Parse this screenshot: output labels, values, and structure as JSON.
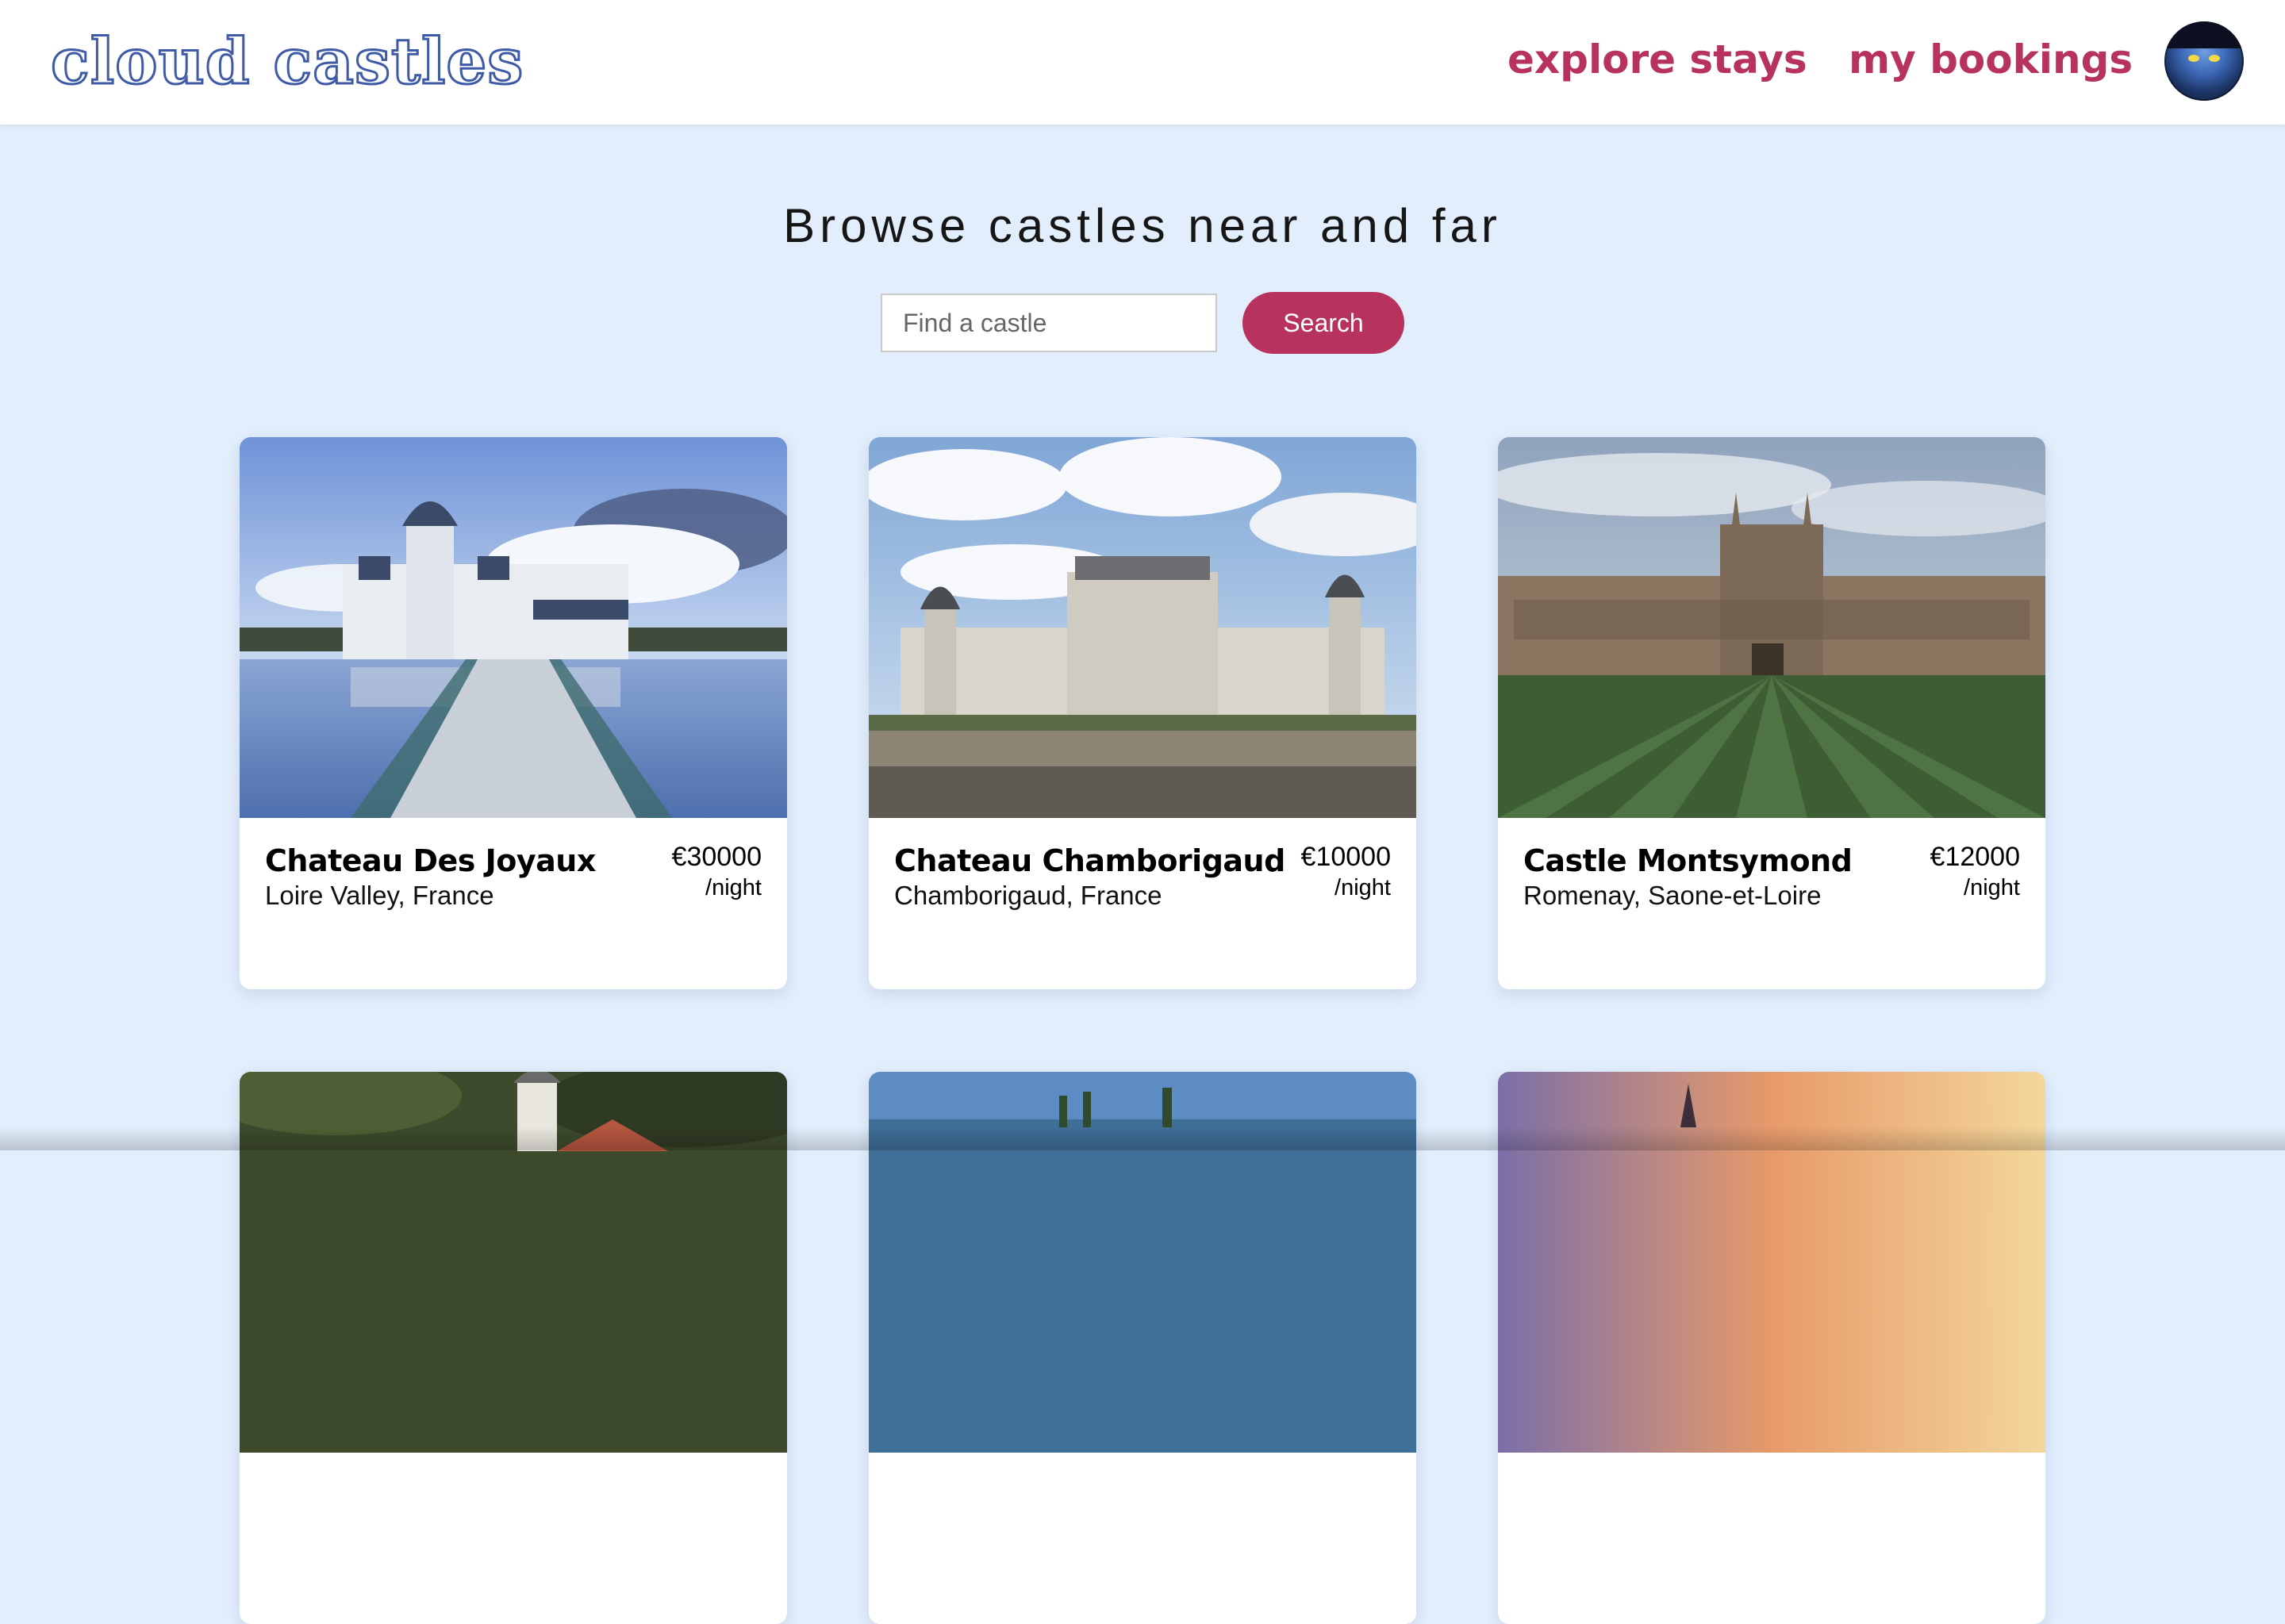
{
  "header": {
    "logo": "cloud castles",
    "nav": {
      "explore": "explore stays",
      "bookings": "my bookings"
    },
    "avatar_icon": "user-avatar-icon"
  },
  "hero": {
    "title": "Browse castles near and far"
  },
  "search": {
    "placeholder": "Find a castle",
    "value": "",
    "button_label": "Search"
  },
  "colors": {
    "accent": "#b8325e",
    "logo": "#3f5aa6",
    "page_background": "#e2eefc"
  },
  "listings": [
    {
      "name": "Chateau Des Joyaux",
      "location": "Loire Valley, France",
      "price": "€30000",
      "unit": "/night"
    },
    {
      "name": "Chateau Chamborigaud",
      "location": "Chamborigaud, France",
      "price": "€10000",
      "unit": "/night"
    },
    {
      "name": "Castle Montsymond",
      "location": "Romenay, Saone-et-Loire",
      "price": "€12000",
      "unit": "/night"
    },
    {
      "name": "",
      "location": "",
      "price": "",
      "unit": ""
    },
    {
      "name": "",
      "location": "",
      "price": "",
      "unit": ""
    },
    {
      "name": "",
      "location": "",
      "price": "",
      "unit": ""
    }
  ]
}
